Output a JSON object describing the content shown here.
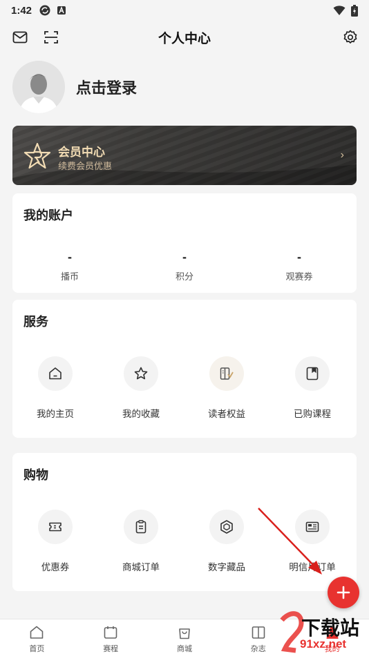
{
  "status_bar": {
    "time": "1:42"
  },
  "header": {
    "title": "个人中心"
  },
  "profile": {
    "login_text": "点击登录"
  },
  "vip": {
    "title": "会员中心",
    "subtitle": "续费会员优惠",
    "arrow": "›"
  },
  "account": {
    "title": "我的账户",
    "items": [
      {
        "value": "-",
        "label": "播币"
      },
      {
        "value": "-",
        "label": "积分"
      },
      {
        "value": "-",
        "label": "观赛券"
      }
    ]
  },
  "services": {
    "title": "服务",
    "items": [
      {
        "label": "我的主页",
        "icon": "home-icon"
      },
      {
        "label": "我的收藏",
        "icon": "star-icon"
      },
      {
        "label": "读者权益",
        "icon": "reader-benefit-icon"
      },
      {
        "label": "已购课程",
        "icon": "course-icon"
      }
    ]
  },
  "shopping": {
    "title": "购物",
    "items": [
      {
        "label": "优惠券",
        "icon": "coupon-icon"
      },
      {
        "label": "商城订单",
        "icon": "clipboard-icon"
      },
      {
        "label": "数字藏品",
        "icon": "cube-icon"
      },
      {
        "label": "明信片订单",
        "icon": "postcard-icon"
      }
    ]
  },
  "tabs": [
    {
      "label": "首页",
      "icon": "home-icon"
    },
    {
      "label": "赛程",
      "icon": "calendar-icon"
    },
    {
      "label": "商城",
      "icon": "bag-icon"
    },
    {
      "label": "杂志",
      "icon": "magazine-icon"
    },
    {
      "label": "我的",
      "icon": "user-icon"
    }
  ],
  "watermark": {
    "line1": "下载站",
    "line2": "91xz.net"
  },
  "colors": {
    "accent": "#e8322f",
    "vip_gold": "#f2dcb4",
    "background": "#f4f4f4"
  }
}
